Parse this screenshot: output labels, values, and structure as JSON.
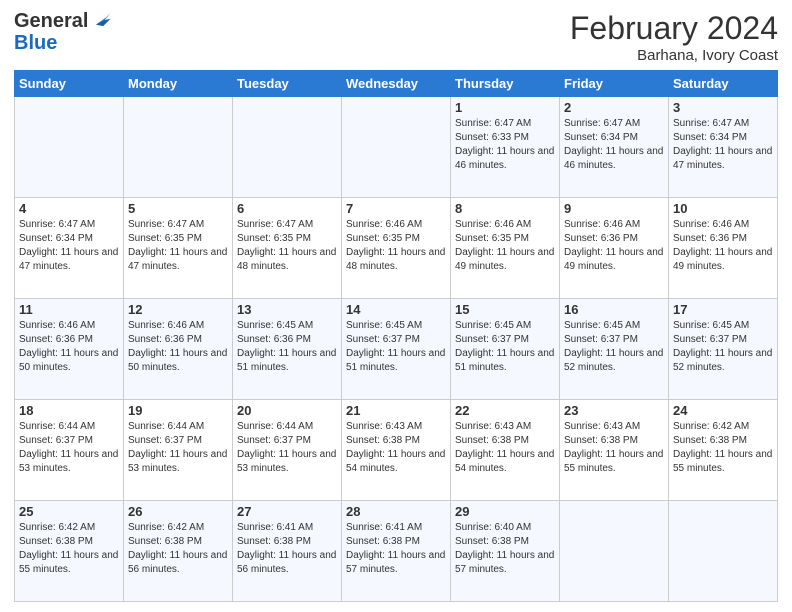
{
  "header": {
    "logo_general": "General",
    "logo_blue": "Blue",
    "month_year": "February 2024",
    "location": "Barhana, Ivory Coast"
  },
  "weekdays": [
    "Sunday",
    "Monday",
    "Tuesday",
    "Wednesday",
    "Thursday",
    "Friday",
    "Saturday"
  ],
  "weeks": [
    [
      {
        "day": "",
        "info": ""
      },
      {
        "day": "",
        "info": ""
      },
      {
        "day": "",
        "info": ""
      },
      {
        "day": "",
        "info": ""
      },
      {
        "day": "1",
        "info": "Sunrise: 6:47 AM\nSunset: 6:33 PM\nDaylight: 11 hours and 46 minutes."
      },
      {
        "day": "2",
        "info": "Sunrise: 6:47 AM\nSunset: 6:34 PM\nDaylight: 11 hours and 46 minutes."
      },
      {
        "day": "3",
        "info": "Sunrise: 6:47 AM\nSunset: 6:34 PM\nDaylight: 11 hours and 47 minutes."
      }
    ],
    [
      {
        "day": "4",
        "info": "Sunrise: 6:47 AM\nSunset: 6:34 PM\nDaylight: 11 hours and 47 minutes."
      },
      {
        "day": "5",
        "info": "Sunrise: 6:47 AM\nSunset: 6:35 PM\nDaylight: 11 hours and 47 minutes."
      },
      {
        "day": "6",
        "info": "Sunrise: 6:47 AM\nSunset: 6:35 PM\nDaylight: 11 hours and 48 minutes."
      },
      {
        "day": "7",
        "info": "Sunrise: 6:46 AM\nSunset: 6:35 PM\nDaylight: 11 hours and 48 minutes."
      },
      {
        "day": "8",
        "info": "Sunrise: 6:46 AM\nSunset: 6:35 PM\nDaylight: 11 hours and 49 minutes."
      },
      {
        "day": "9",
        "info": "Sunrise: 6:46 AM\nSunset: 6:36 PM\nDaylight: 11 hours and 49 minutes."
      },
      {
        "day": "10",
        "info": "Sunrise: 6:46 AM\nSunset: 6:36 PM\nDaylight: 11 hours and 49 minutes."
      }
    ],
    [
      {
        "day": "11",
        "info": "Sunrise: 6:46 AM\nSunset: 6:36 PM\nDaylight: 11 hours and 50 minutes."
      },
      {
        "day": "12",
        "info": "Sunrise: 6:46 AM\nSunset: 6:36 PM\nDaylight: 11 hours and 50 minutes."
      },
      {
        "day": "13",
        "info": "Sunrise: 6:45 AM\nSunset: 6:36 PM\nDaylight: 11 hours and 51 minutes."
      },
      {
        "day": "14",
        "info": "Sunrise: 6:45 AM\nSunset: 6:37 PM\nDaylight: 11 hours and 51 minutes."
      },
      {
        "day": "15",
        "info": "Sunrise: 6:45 AM\nSunset: 6:37 PM\nDaylight: 11 hours and 51 minutes."
      },
      {
        "day": "16",
        "info": "Sunrise: 6:45 AM\nSunset: 6:37 PM\nDaylight: 11 hours and 52 minutes."
      },
      {
        "day": "17",
        "info": "Sunrise: 6:45 AM\nSunset: 6:37 PM\nDaylight: 11 hours and 52 minutes."
      }
    ],
    [
      {
        "day": "18",
        "info": "Sunrise: 6:44 AM\nSunset: 6:37 PM\nDaylight: 11 hours and 53 minutes."
      },
      {
        "day": "19",
        "info": "Sunrise: 6:44 AM\nSunset: 6:37 PM\nDaylight: 11 hours and 53 minutes."
      },
      {
        "day": "20",
        "info": "Sunrise: 6:44 AM\nSunset: 6:37 PM\nDaylight: 11 hours and 53 minutes."
      },
      {
        "day": "21",
        "info": "Sunrise: 6:43 AM\nSunset: 6:38 PM\nDaylight: 11 hours and 54 minutes."
      },
      {
        "day": "22",
        "info": "Sunrise: 6:43 AM\nSunset: 6:38 PM\nDaylight: 11 hours and 54 minutes."
      },
      {
        "day": "23",
        "info": "Sunrise: 6:43 AM\nSunset: 6:38 PM\nDaylight: 11 hours and 55 minutes."
      },
      {
        "day": "24",
        "info": "Sunrise: 6:42 AM\nSunset: 6:38 PM\nDaylight: 11 hours and 55 minutes."
      }
    ],
    [
      {
        "day": "25",
        "info": "Sunrise: 6:42 AM\nSunset: 6:38 PM\nDaylight: 11 hours and 55 minutes."
      },
      {
        "day": "26",
        "info": "Sunrise: 6:42 AM\nSunset: 6:38 PM\nDaylight: 11 hours and 56 minutes."
      },
      {
        "day": "27",
        "info": "Sunrise: 6:41 AM\nSunset: 6:38 PM\nDaylight: 11 hours and 56 minutes."
      },
      {
        "day": "28",
        "info": "Sunrise: 6:41 AM\nSunset: 6:38 PM\nDaylight: 11 hours and 57 minutes."
      },
      {
        "day": "29",
        "info": "Sunrise: 6:40 AM\nSunset: 6:38 PM\nDaylight: 11 hours and 57 minutes."
      },
      {
        "day": "",
        "info": ""
      },
      {
        "day": "",
        "info": ""
      }
    ]
  ]
}
